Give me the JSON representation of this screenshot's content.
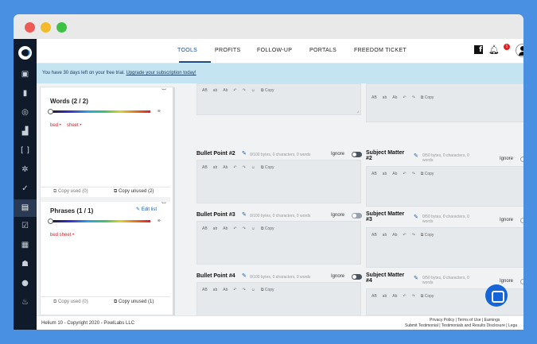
{
  "nav": {
    "tabs": [
      "TOOLS",
      "PROFITS",
      "FOLLOW-UP",
      "PORTALS",
      "FREEDOM TICKET"
    ],
    "notification_count": "1",
    "icons": [
      "facebook-icon",
      "bell-icon",
      "user-avatar-icon"
    ]
  },
  "trial": {
    "text": "You have 30 days left on your free trial. ",
    "link": "Upgrade your subscription today!"
  },
  "words": {
    "title": "Words (2 / 2)",
    "items": [
      "bed",
      "sheet"
    ],
    "copy_used": "Copy used (0)",
    "copy_unused": "Copy unused (2)"
  },
  "phrases": {
    "title": "Phrases (1 / 1)",
    "edit_label": "Edit list",
    "items": [
      "bed sheet"
    ],
    "copy_used": "Copy used (0)",
    "copy_unused": "Copy unused (1)"
  },
  "toolbar": {
    "ab1": "AB",
    "ab2": "ab",
    "ab3": "Ab",
    "copy": "Copy"
  },
  "fields": {
    "bp2": {
      "label": "Bullet Point #2",
      "meta": "0/100 bytes, 0 characters, 0 words",
      "ignore": "Ignore"
    },
    "bp3": {
      "label": "Bullet Point #3",
      "meta": "0/100 bytes, 0 characters, 0 words",
      "ignore": "Ignore"
    },
    "bp4": {
      "label": "Bullet Point #4",
      "meta": "0/100 bytes, 0 characters, 0 words",
      "ignore": "Ignore"
    },
    "sm2": {
      "label_a": "Subject Matter",
      "label_b": "#2",
      "meta_a": "0/50 bytes, 0 characters, 0",
      "meta_b": "words",
      "ignore": "Ignore"
    },
    "sm3": {
      "label_a": "Subject Matter",
      "label_b": "#3",
      "meta_a": "0/50 bytes, 0 characters, 0",
      "meta_b": "words",
      "ignore": "Ignore"
    },
    "sm4": {
      "label_a": "Subject Matter",
      "label_b": "#4",
      "meta_a": "0/50 bytes, 0 characters, 0",
      "meta_b": "words",
      "ignore": "Ignore"
    }
  },
  "footer": {
    "copyright": "Helium 10 - Copyright 2020 - PixelLabs LLC",
    "links1": "Privacy Policy | Terms of Use | Earnings",
    "links2": "Submit Testimonial | Testimonials and Results Disclosure | Lega"
  }
}
